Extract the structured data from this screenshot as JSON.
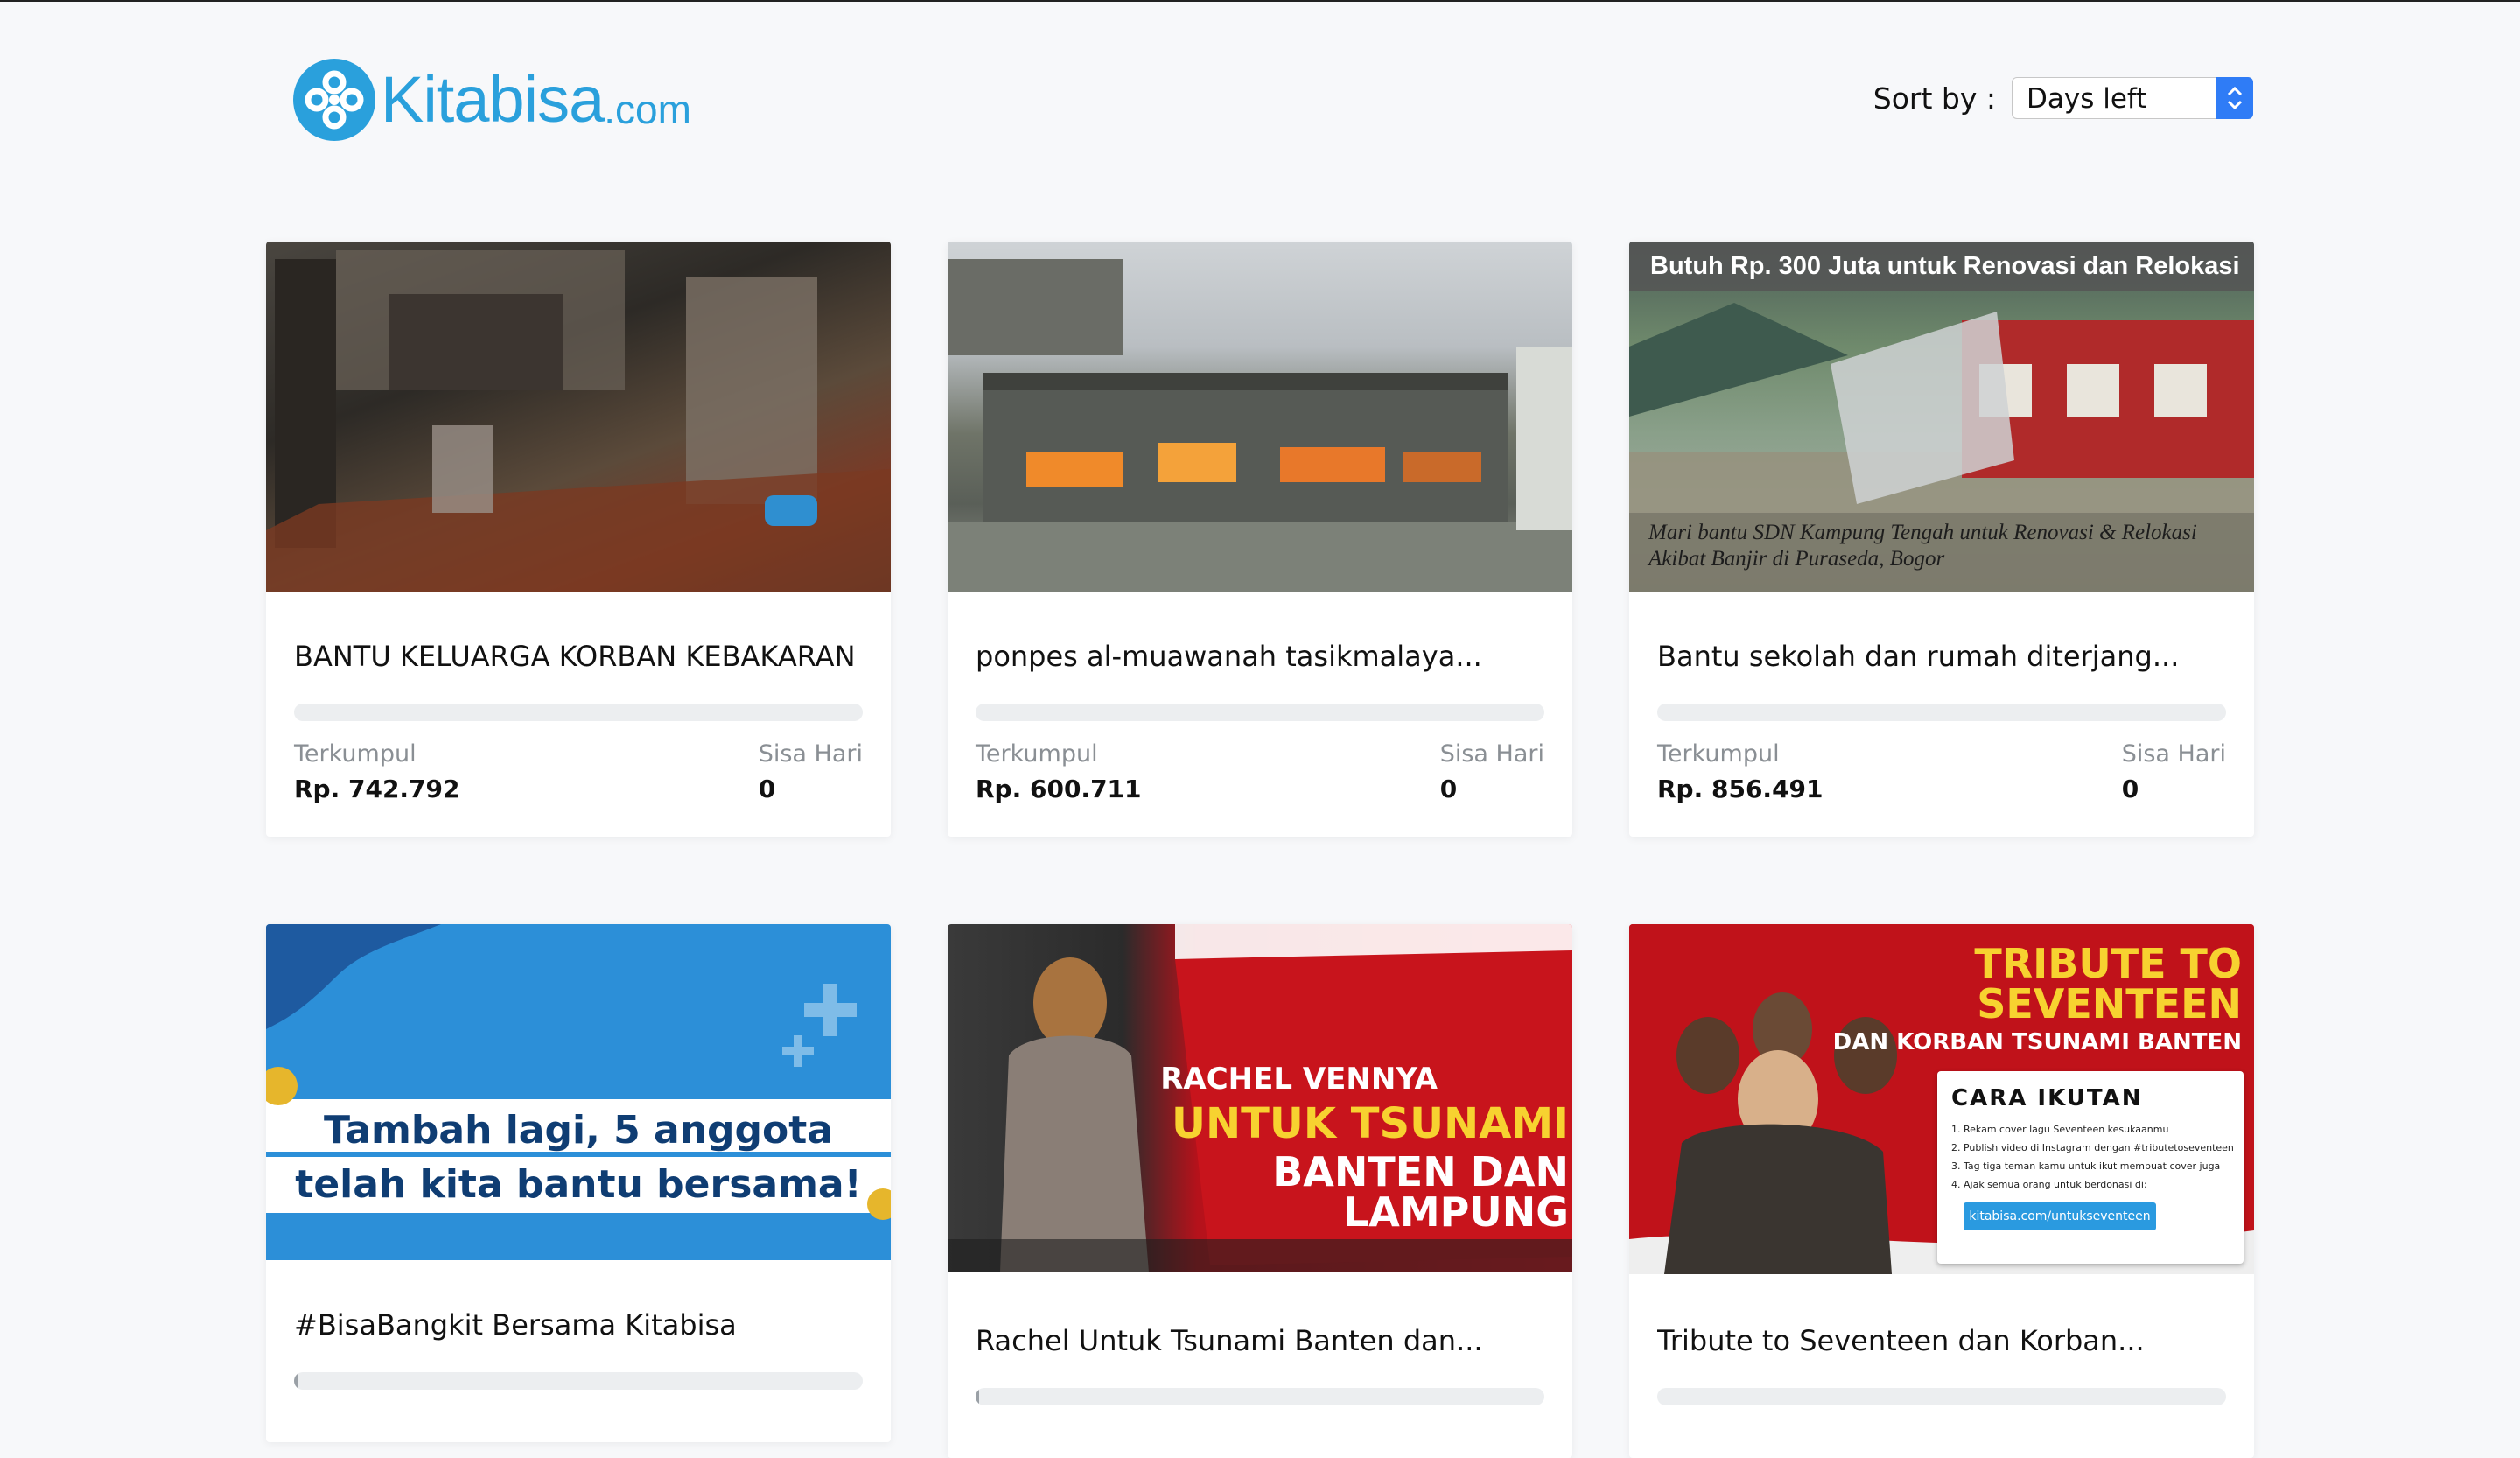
{
  "header": {
    "logo_text": "Kitabisa",
    "logo_suffix": ".com",
    "sort_label": "Sort by :",
    "sort_value": "Days left"
  },
  "campaigns": [
    {
      "title": "BANTU KELUARGA KORBAN KEBAKARAN",
      "collected_label": "Terkumpul",
      "collected_value": "Rp. 742.792",
      "days_label": "Sisa Hari",
      "days_value": "0",
      "progress": 0
    },
    {
      "title": "ponpes al-muawanah tasikmalaya...",
      "collected_label": "Terkumpul",
      "collected_value": "Rp. 600.711",
      "days_label": "Sisa Hari",
      "days_value": "0",
      "progress": 0
    },
    {
      "title": "Bantu sekolah dan rumah diterjang...",
      "image_banner": "Butuh Rp. 300 Juta untuk Renovasi dan Relokasi",
      "image_caption_line1": "Mari bantu SDN Kampung Tengah untuk Renovasi & Relokasi",
      "image_caption_line2": "Akibat Banjir di Puraseda, Bogor",
      "collected_label": "Terkumpul",
      "collected_value": "Rp. 856.491",
      "days_label": "Sisa Hari",
      "days_value": "0",
      "progress": 0
    },
    {
      "title": "#BisaBangkit Bersama Kitabisa",
      "image_line1": "Tambah lagi, 5 anggota",
      "image_line2": "telah kita bantu bersama!",
      "progress": 0.01
    },
    {
      "title": "Rachel Untuk Tsunami Banten dan...",
      "image_line1": "RACHEL VENNYA",
      "image_line2": "UNTUK TSUNAMI",
      "image_line3": "BANTEN DAN LAMPUNG",
      "progress": 0.01
    },
    {
      "title": "Tribute to Seventeen dan Korban...",
      "image_line1": "TRIBUTE TO SEVENTEEN",
      "image_line2": "DAN KORBAN TSUNAMI BANTEN",
      "box_title": "CARA IKUTAN",
      "box_steps": [
        "1. Rekam cover lagu Seventeen kesukaanmu",
        "2. Publish video di Instagram dengan #tributetoseventeen",
        "3. Tag tiga teman kamu untuk ikut membuat cover juga",
        "4. Ajak semua orang untuk berdonasi di:"
      ],
      "box_link": "kitabisa.com/untukseventeen",
      "progress": 0
    }
  ],
  "colors": {
    "brand": "#2aa0dc",
    "select_accent": "#2f7cf6",
    "muted_text": "#8a8f94"
  }
}
